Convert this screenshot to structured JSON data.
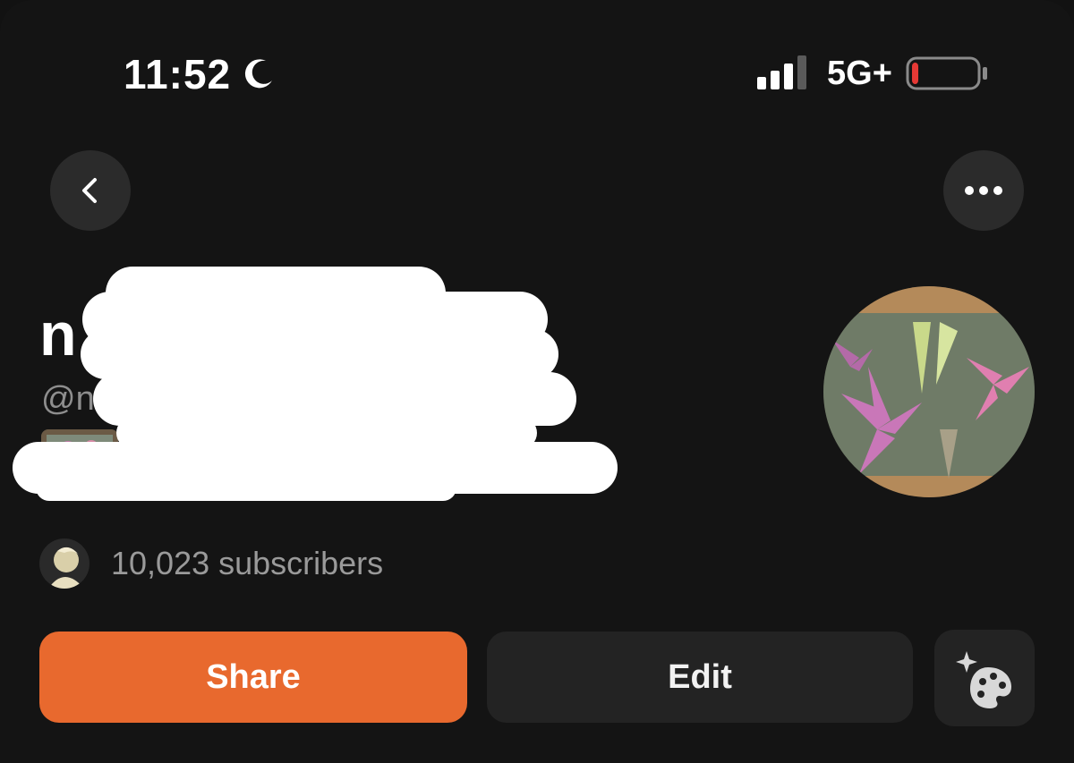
{
  "status_bar": {
    "time": "11:52",
    "network": "5G+",
    "icons": [
      "moon-icon",
      "signal-icon",
      "battery-icon"
    ],
    "battery_level": 0.1,
    "battery_color": "#e53935"
  },
  "nav": {
    "back_icon": "chevron-left-icon",
    "more_icon": "ellipsis-icon"
  },
  "profile": {
    "name": "n",
    "handle": "@n",
    "subscribers": "10,023 subscribers"
  },
  "actions": {
    "share_label": "Share",
    "edit_label": "Edit",
    "theme_icon": "palette-sparkle-icon"
  },
  "colors": {
    "background": "#141414",
    "accent": "#e8692e",
    "surface": "#2b2b2b",
    "muted_text": "#8e8e8e"
  }
}
